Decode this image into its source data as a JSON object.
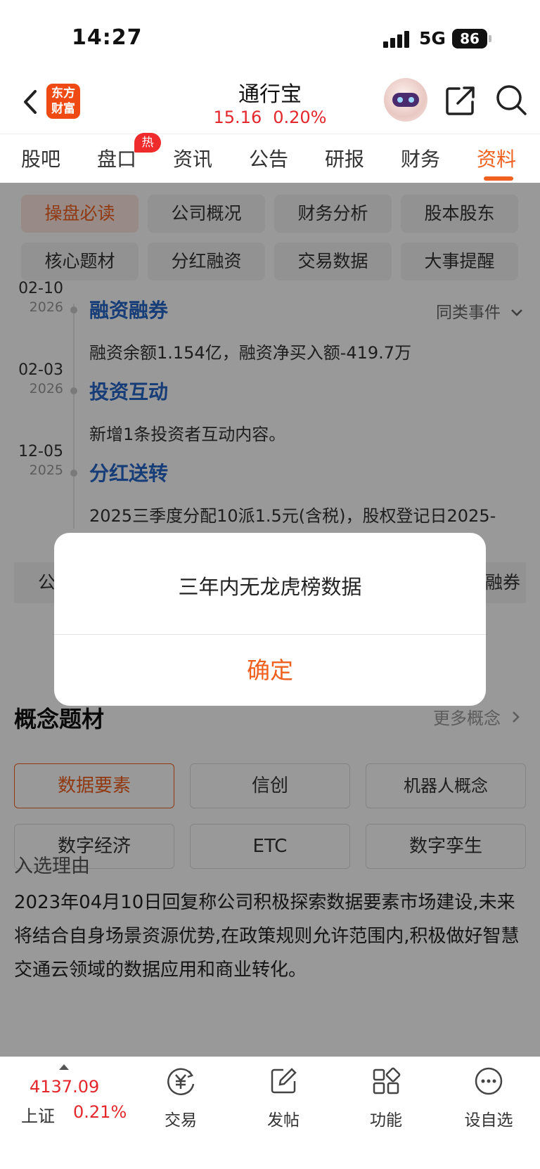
{
  "status_bar": {
    "time": "14:27",
    "network": "5G",
    "battery": "86"
  },
  "header": {
    "logo_line1": "东方",
    "logo_line2": "财富",
    "title": "通行宝",
    "price": "15.16",
    "change_pct": "0.20%"
  },
  "tabs": {
    "items": [
      "股吧",
      "盘口",
      "资讯",
      "公告",
      "研报",
      "财务",
      "资料"
    ],
    "hot_badge": "热",
    "active": "资料"
  },
  "chips": {
    "row1": [
      "操盘必读",
      "公司概况",
      "财务分析",
      "股本股东"
    ],
    "row2": [
      "核心题材",
      "分红融资",
      "交易数据",
      "大事提醒"
    ]
  },
  "events": {
    "same_event_label": "同类事件",
    "items": [
      {
        "date": "02-10",
        "year": "2026",
        "title": "融资融券",
        "desc": "融资余额1.154亿，融资净买入额-419.7万"
      },
      {
        "date": "02-03",
        "year": "2026",
        "title": "投资互动",
        "desc": "新增1条投资者互动内容。"
      },
      {
        "date": "12-05",
        "year": "2025",
        "title": "分红送转",
        "desc": "2025三季度分配10派1.5元(含税)，股权登记日2025-"
      }
    ]
  },
  "hidden_tabs": {
    "left": "公",
    "right": "融券"
  },
  "concepts": {
    "section_title": "概念题材",
    "more": "更多概念",
    "items": [
      "数据要素",
      "信创",
      "机器人概念",
      "数字经济",
      "ETC",
      "数字孪生"
    ],
    "reason_label": "入选理由",
    "reason_text": "2023年04月10日回复称公司积极探索数据要素市场建设,未来将结合自身场景资源优势,在政策规则允许范围内,积极做好智慧交通云领域的数据应用和商业转化。"
  },
  "dialog": {
    "message": "三年内无龙虎榜数据",
    "confirm": "确定"
  },
  "bottom_bar": {
    "index_value": "4137.09",
    "index_name": "上证",
    "index_pct": "0.21%",
    "nav": [
      "交易",
      "发帖",
      "功能",
      "设自选"
    ]
  },
  "colors": {
    "accent": "#f0601e",
    "up": "#e4272d",
    "link": "#2566c8"
  }
}
